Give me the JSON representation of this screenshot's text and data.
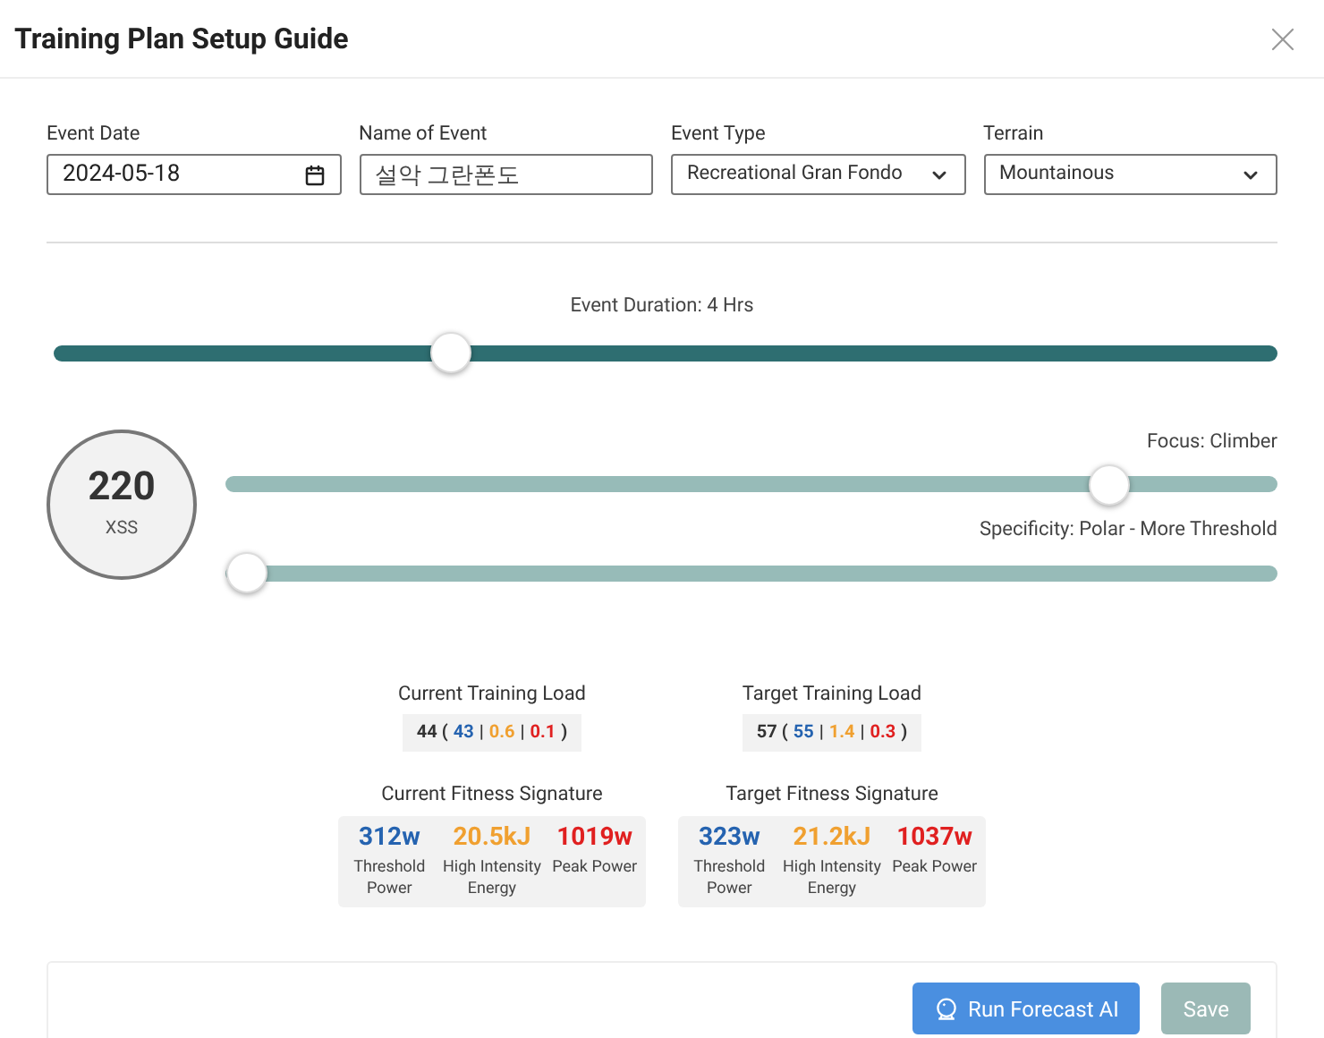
{
  "window": {
    "title": "Training Plan Setup Guide"
  },
  "fields": [
    {
      "label": "Event Date",
      "kind": "date",
      "value": "2024-05-18"
    },
    {
      "label": "Name of Event",
      "kind": "text",
      "value": "설악 그란폰도"
    },
    {
      "label": "Event Type",
      "kind": "select",
      "value": "Recreational Gran Fondo"
    },
    {
      "label": "Terrain",
      "kind": "select",
      "value": "Mountainous"
    }
  ],
  "duration": {
    "label": "Event Duration: 4 Hrs",
    "level": 0.325
  },
  "score": {
    "value": "220",
    "unit": "XSS"
  },
  "sliders": [
    {
      "label": "Focus: Climber",
      "level": 0.84
    },
    {
      "label": "Specificity: Polar - More Threshold",
      "level": 0.02
    }
  ],
  "loads": [
    {
      "title": "Current Training Load",
      "segments": [
        {
          "text": "44 ("
        },
        {
          "text": "43",
          "color": "#2563b0"
        },
        {
          "text": "|"
        },
        {
          "text": "0.6",
          "color": "#f0a030"
        },
        {
          "text": "|"
        },
        {
          "text": "0.1",
          "color": "#e02020"
        },
        {
          "text": ")"
        }
      ]
    },
    {
      "title": "Target Training Load",
      "segments": [
        {
          "text": "57 ("
        },
        {
          "text": "55",
          "color": "#2563b0"
        },
        {
          "text": "|"
        },
        {
          "text": "1.4",
          "color": "#f0a030"
        },
        {
          "text": "|"
        },
        {
          "text": "0.3",
          "color": "#e02020"
        },
        {
          "text": ")"
        }
      ]
    }
  ],
  "signatures": [
    {
      "title": "Current Fitness Signature",
      "metrics": [
        {
          "value": "312w",
          "label": "Threshold Power",
          "color": "#2563b0"
        },
        {
          "value": "20.5kJ",
          "label": "High Intensity Energy",
          "color": "#f0a030"
        },
        {
          "value": "1019w",
          "label": "Peak Power",
          "color": "#e02020"
        }
      ]
    },
    {
      "title": "Target Fitness Signature",
      "metrics": [
        {
          "value": "323w",
          "label": "Threshold Power",
          "color": "#2563b0"
        },
        {
          "value": "21.2kJ",
          "label": "High Intensity Energy",
          "color": "#f0a030"
        },
        {
          "value": "1037w",
          "label": "Peak Power",
          "color": "#e02020"
        }
      ]
    }
  ],
  "buttons": [
    {
      "label": "Run Forecast AI",
      "kind": "primary",
      "disabled": false
    },
    {
      "label": "Save",
      "kind": "secondary",
      "disabled": true
    }
  ]
}
